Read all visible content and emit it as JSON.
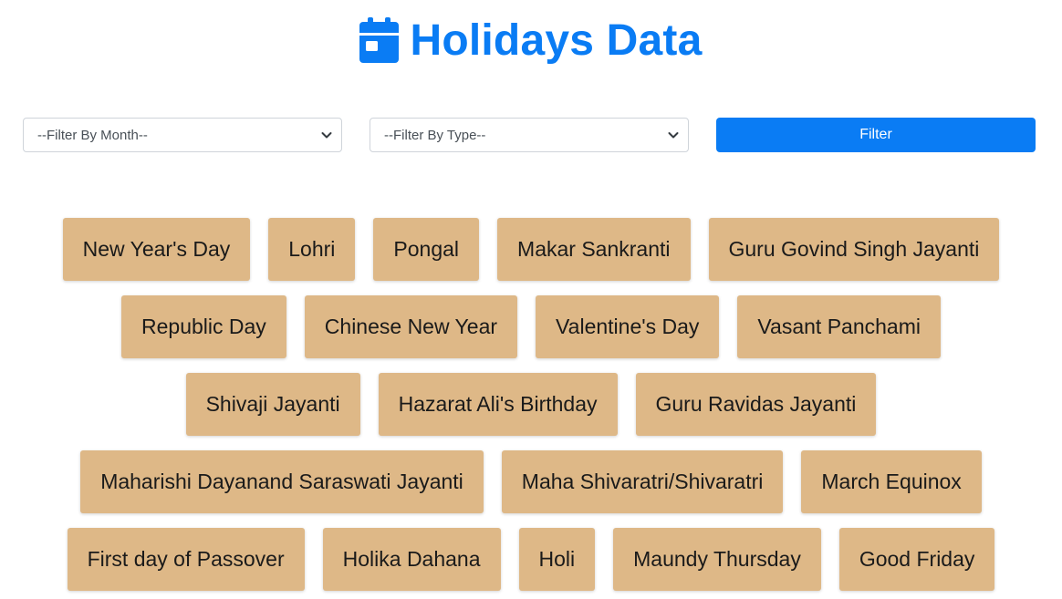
{
  "header": {
    "title": "Holidays Data",
    "icon": "calendar-icon",
    "color": "#0a7cf4"
  },
  "filters": {
    "month_select": "--Filter By Month--",
    "type_select": "--Filter By Type--",
    "filter_button": "Filter",
    "button_color": "#0a7cf4"
  },
  "holidays": {
    "chip_color": "#deb887",
    "rows": [
      [
        "New Year's Day",
        "Lohri",
        "Pongal",
        "Makar Sankranti",
        "Guru Govind Singh Jayanti"
      ],
      [
        "Republic Day",
        "Chinese New Year",
        "Valentine's Day",
        "Vasant Panchami"
      ],
      [
        "Shivaji Jayanti",
        "Hazarat Ali's Birthday",
        "Guru Ravidas Jayanti"
      ],
      [
        "Maharishi Dayanand Saraswati Jayanti",
        "Maha Shivaratri/Shivaratri",
        "March Equinox"
      ],
      [
        "First day of Passover",
        "Holika Dahana",
        "Holi",
        "Maundy Thursday",
        "Good Friday"
      ]
    ]
  }
}
